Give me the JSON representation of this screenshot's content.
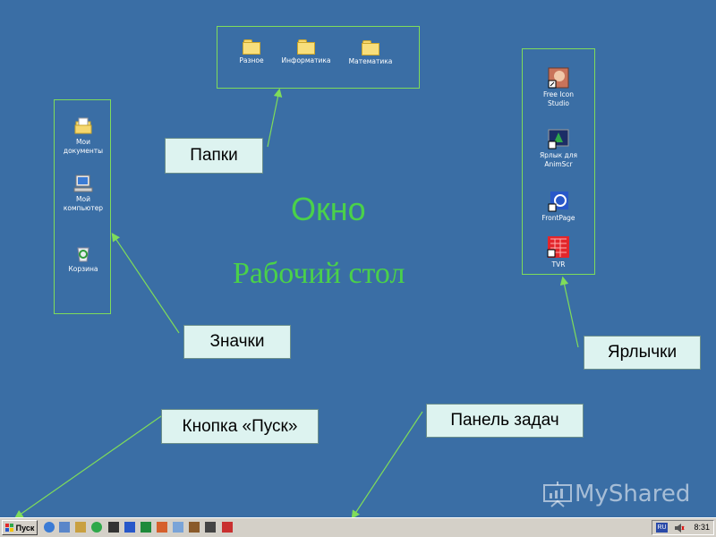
{
  "folders": [
    {
      "label": "Разное",
      "icon": "folder-icon"
    },
    {
      "label": "Информатика",
      "icon": "folder-icon"
    },
    {
      "label": "Математика",
      "icon": "folder-icon"
    }
  ],
  "desktop_icons": [
    {
      "label": "Мои\nдокументы",
      "icon": "my-documents-icon"
    },
    {
      "label": "Мой\nкомпьютер",
      "icon": "my-computer-icon"
    },
    {
      "label": "Корзина",
      "icon": "recycle-bin-icon"
    }
  ],
  "shortcuts": [
    {
      "label": "Free Icon\nStudio",
      "icon": "free-icon-studio-shortcut-icon"
    },
    {
      "label": "Ярлык для\nAnimScr",
      "icon": "animscr-shortcut-icon"
    },
    {
      "label": "FrontPage",
      "icon": "frontpage-shortcut-icon"
    },
    {
      "label": "TVR",
      "icon": "tvr-shortcut-icon"
    }
  ],
  "callouts": {
    "folders": "Папки",
    "icons": "Значки",
    "shortcuts": "Ярлычки",
    "start_button": "Кнопка «Пуск»",
    "taskbar": "Панель задач"
  },
  "headings": {
    "window": "Окно",
    "desktop": "Рабочий стол"
  },
  "taskbar": {
    "start_label": "Пуск",
    "language": "RU",
    "clock": "8:31"
  },
  "watermark": "MyShared",
  "colors": {
    "desktop_bg": "#3a6ea5",
    "accent_green": "#4ad14a",
    "callout_bg": "#ddf3f0"
  }
}
